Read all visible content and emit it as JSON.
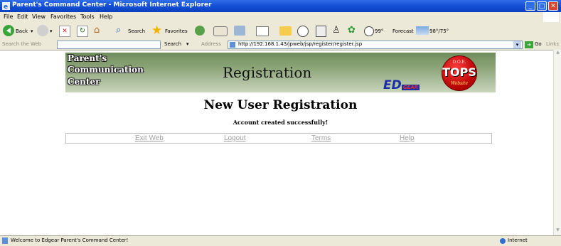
{
  "window": {
    "title": "Parent's Command Center - Microsoft Internet Explorer",
    "controls": {
      "minimize": "_",
      "maximize": "□",
      "close": "✕"
    }
  },
  "menu": {
    "items": [
      "File",
      "Edit",
      "View",
      "Favorites",
      "Tools",
      "Help"
    ]
  },
  "toolbar": {
    "back": "Back",
    "search": "Search",
    "favorites": "Favorites",
    "temperature": "99°",
    "forecast": "Forecast",
    "forecast_temp": "98°/75°"
  },
  "addressbar": {
    "search_the_web": "Search the Web",
    "search_btn": "Search",
    "address_label": "Address",
    "url": "http://192.168.1.43/jpweb/jsp/register/register.jsp",
    "go": "Go",
    "links": "Links"
  },
  "banner": {
    "line1": "Parent's",
    "line2": "Communication",
    "line3": "Center",
    "registration": "Registration",
    "ed_logo_main": "ED",
    "ed_logo_sub": "GEAR",
    "tops_top": "D.O.E.",
    "tops": "TOPS",
    "tops_bottom": "Website"
  },
  "page": {
    "heading": "New User Registration",
    "message": "Account created successfully!"
  },
  "nav": {
    "items": [
      "Exit Web",
      "Logout",
      "Terms",
      "Help"
    ]
  },
  "status": {
    "text": "Welcome to Edgear Parent's Command Center!",
    "zone": "Internet"
  },
  "colors": {
    "titlebar": "#1651d6",
    "chrome": "#ece9d8",
    "banner_green": "#8ea67a",
    "link_gray": "#a0a0a0"
  }
}
